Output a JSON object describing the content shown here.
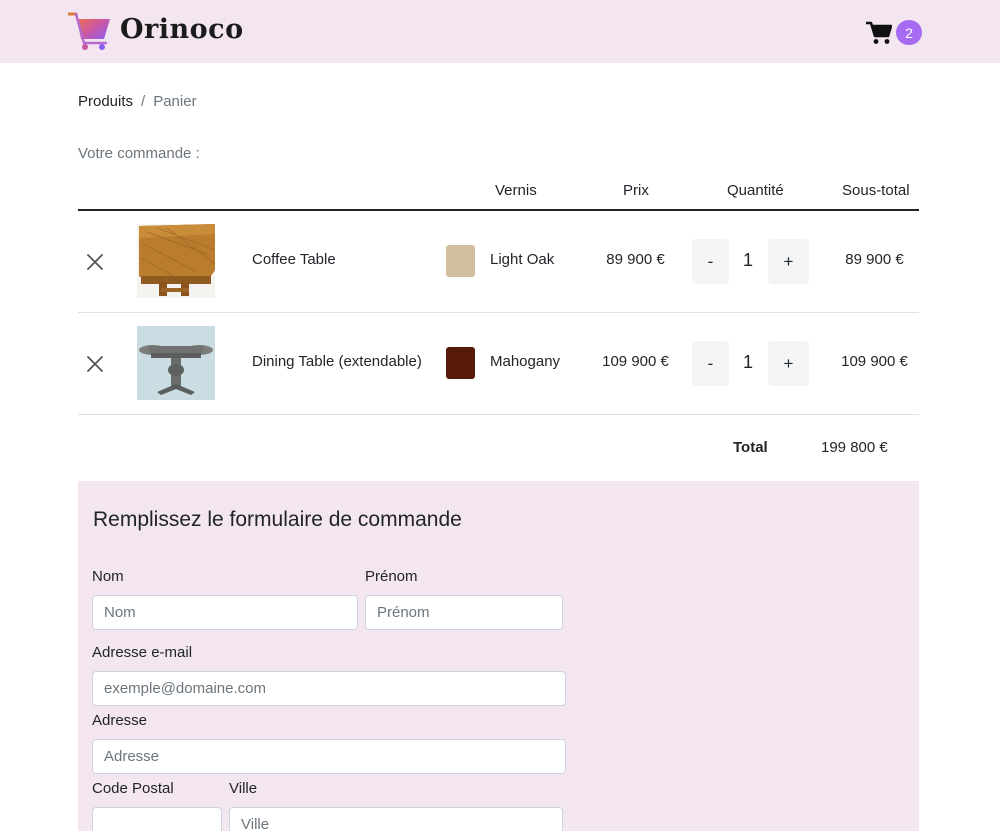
{
  "header": {
    "brand": "Orinoco",
    "cart_count": "2"
  },
  "breadcrumb": {
    "products": "Produits",
    "separator": "/",
    "current": "Panier"
  },
  "order": {
    "title": "Votre commande :",
    "columns": {
      "finish": "Vernis",
      "price": "Prix",
      "quantity": "Quantité",
      "subtotal": "Sous-total"
    },
    "items": [
      {
        "name": "Coffee Table",
        "finish": "Light Oak",
        "finish_color": "#d2bd9d",
        "price": "89 900 €",
        "quantity": "1",
        "subtotal": "89 900 €",
        "minus": "-",
        "plus": "+"
      },
      {
        "name": "Dining Table (extendable)",
        "finish": "Mahogany",
        "finish_color": "#571a08",
        "price": "109 900 €",
        "quantity": "1",
        "subtotal": "109 900 €",
        "minus": "-",
        "plus": "+"
      }
    ],
    "total_label": "Total",
    "total_value": "199 800 €"
  },
  "form": {
    "title": "Remplissez le formulaire de commande",
    "last_name_label": "Nom",
    "last_name_placeholder": "Nom",
    "first_name_label": "Prénom",
    "first_name_placeholder": "Prénom",
    "email_label": "Adresse e-mail",
    "email_placeholder": "exemple@domaine.com",
    "address_label": "Adresse",
    "address_placeholder": "Adresse",
    "postal_label": "Code Postal",
    "postal_placeholder": "",
    "city_label": "Ville",
    "city_placeholder": "Ville"
  },
  "colors": {
    "header_bg": "#f3e6f0",
    "accent": "#a66af3",
    "form_bg": "#f3e6f0"
  },
  "icons": {
    "logo": "shopping-cart-gradient-icon",
    "cart": "shopping-cart-icon",
    "remove": "close-icon"
  }
}
